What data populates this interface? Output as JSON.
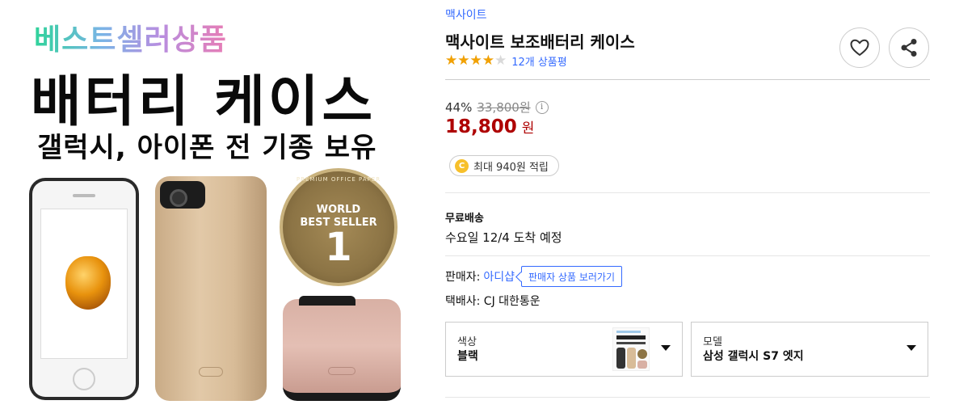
{
  "product_image": {
    "headline_gradient": "베스트셀러상품",
    "headline_main": "배터리 케이스",
    "headline_sub": "갤럭시, 아이폰 전 기종 보유",
    "badge_ring_text": "PREMIUM OFFICE PAPER",
    "badge_line1": "WORLD",
    "badge_line2": "BEST SELLER",
    "badge_number": "1"
  },
  "product": {
    "brand": "맥사이트",
    "title": "맥사이트 보조배터리 케이스",
    "rating": 4,
    "rating_max": 5,
    "review_count": "12개 상품평",
    "discount_rate": "44%",
    "original_price": "33,800원",
    "sale_price": "18,800",
    "currency": "원",
    "reward_coin": "C",
    "reward_text": "최대 940원 적립",
    "price_color": "#ae0000",
    "link_color": "#346aff",
    "star_color": "#f2a102"
  },
  "icons": {
    "wishlist": "heart-icon",
    "share": "share-icon",
    "price_info": "info-icon",
    "dropdown": "chevron-down-icon"
  },
  "shipping": {
    "label": "무료배송",
    "arrival": "수요일 12/4 도착 예정"
  },
  "seller": {
    "label": "판매자:",
    "name": "아디샵",
    "view_products_button": "판매자 상품 보러가기",
    "courier": "택배사: CJ 대한통운"
  },
  "options": [
    {
      "label": "색상",
      "value": "블랙"
    },
    {
      "label": "모델",
      "value": "삼성 갤럭시 S7 엣지"
    }
  ]
}
